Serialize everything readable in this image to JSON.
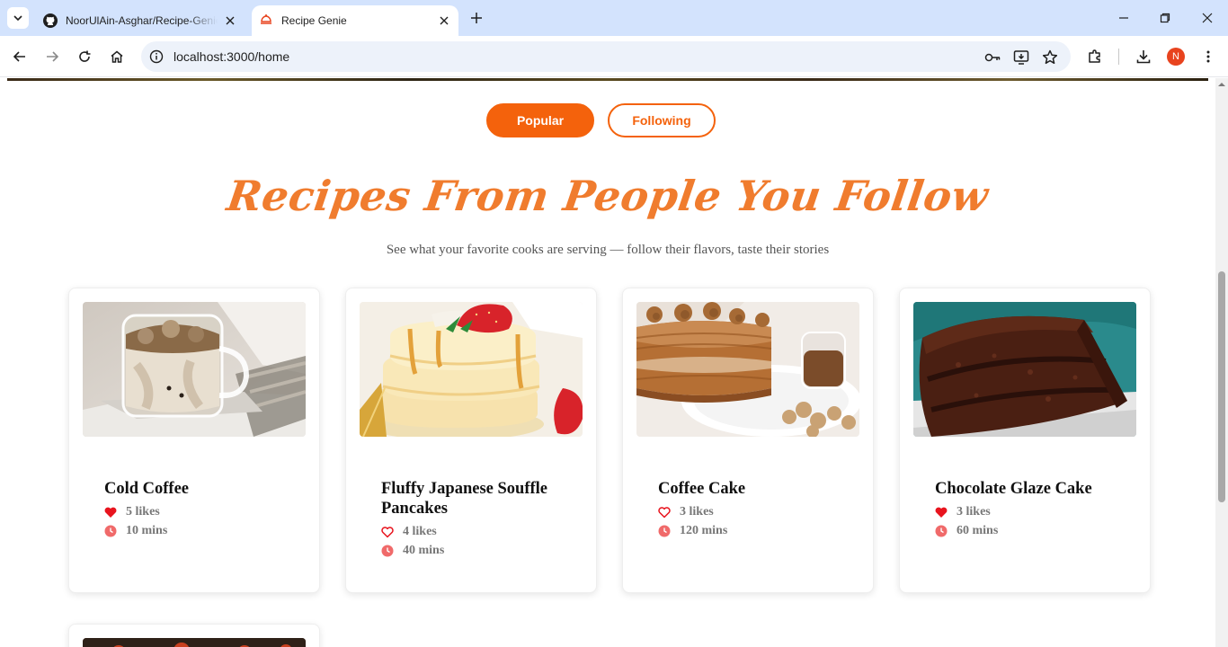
{
  "browser": {
    "tabs": [
      {
        "title": "NoorUlAin-Asghar/Recipe-Genie",
        "active": false
      },
      {
        "title": "Recipe Genie",
        "active": true
      }
    ],
    "url": "localhost:3000/home",
    "profile_initial": "N"
  },
  "filters": {
    "popular_label": "Popular",
    "following_label": "Following",
    "selected": "Popular"
  },
  "section": {
    "title": "Recipes From People You Follow",
    "subtitle": "See what your favorite cooks are serving — follow their flavors, taste their stories"
  },
  "recipes": [
    {
      "name": "Cold Coffee",
      "likes": "5 likes",
      "time": "10 mins",
      "liked": true
    },
    {
      "name": "Fluffy Japanese Souffle Pancakes",
      "likes": "4 likes",
      "time": "40 mins",
      "liked": false
    },
    {
      "name": "Coffee Cake",
      "likes": "3 likes",
      "time": "120 mins",
      "liked": false
    },
    {
      "name": "Chocolate Glaze Cake",
      "likes": "3 likes",
      "time": "60 mins",
      "liked": true
    }
  ],
  "colors": {
    "accent": "#f4620c",
    "heading": "#f07c2e",
    "heart": "#e8141e",
    "clock": "#f06a6a"
  }
}
